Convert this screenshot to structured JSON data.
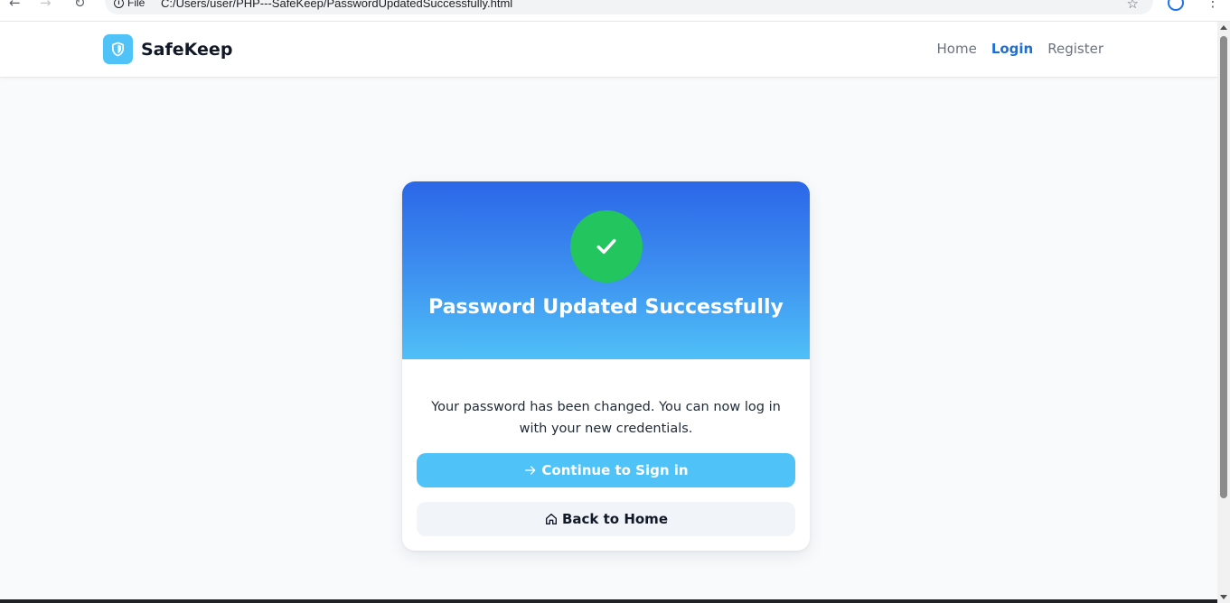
{
  "browser": {
    "site_info": "File",
    "url": "C:/Users/user/PHP---SafeKeep/PasswordUpdatedSuccessfully.html"
  },
  "header": {
    "brand_name": "SafeKeep",
    "brand_icon": "shield-icon",
    "nav": [
      {
        "label": "Home",
        "active": false
      },
      {
        "label": "Login",
        "active": true
      },
      {
        "label": "Register",
        "active": false
      }
    ]
  },
  "card": {
    "status_icon": "check-icon",
    "title": "Password Updated Successfully",
    "message": "Your password has been changed. You can now log in with your new credentials.",
    "primary_button": {
      "label": "Continue to Sign in",
      "icon": "arrow-right-icon"
    },
    "secondary_button": {
      "label": "Back to Home",
      "icon": "home-icon"
    }
  },
  "colors": {
    "brand": "#4fc3f7",
    "accent_link": "#1d6fd8",
    "success": "#22c55e",
    "gradient_top": "#2b67e8",
    "gradient_bottom": "#4fc0f7"
  }
}
